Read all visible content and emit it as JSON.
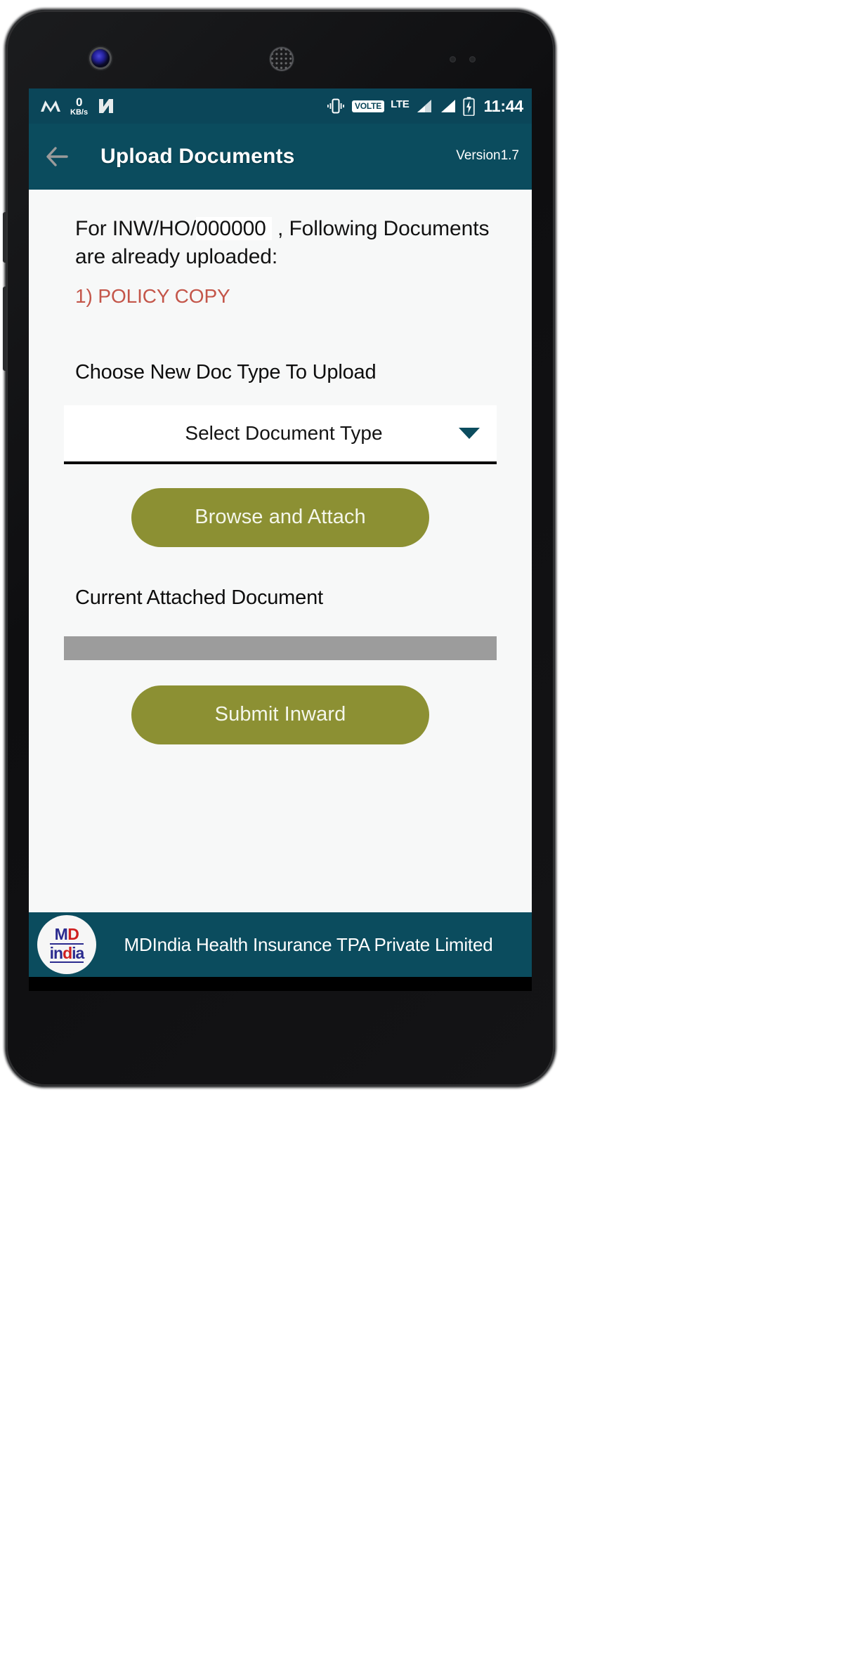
{
  "status_bar": {
    "network_speed_value": "0",
    "network_speed_unit": "KB/s",
    "volte_label": "VOLTE",
    "network_type": "LTE",
    "clock": "11:44",
    "icons": [
      "m-logo-icon",
      "network-speed-icon",
      "android-nougat-icon",
      "vibrate-icon",
      "volte-badge",
      "signal-bar-icon",
      "battery-charging-icon"
    ],
    "background_color": "#0b4659"
  },
  "app_bar": {
    "back_icon": "back-arrow-icon",
    "title": "Upload Documents",
    "version": "Version1.7",
    "background_color": "#0b4c5e"
  },
  "content": {
    "headline_prefix": "For INW/HO/",
    "headline_redacted": "000000",
    "headline_suffix": " , Following Documents are already uploaded:",
    "uploaded_documents": [
      {
        "label": "1) POLICY COPY",
        "color": "#c4564a"
      }
    ],
    "choose_doc_label": "Choose New Doc Type To Upload",
    "doc_type_spinner": {
      "selected": "Select Document Type",
      "placeholder": "Select Document Type",
      "caret_icon": "chevron-down-icon"
    },
    "browse_button_label": "Browse and Attach",
    "current_doc_label": "Current Attached Document",
    "current_doc_value": "",
    "submit_button_label": "Submit Inward",
    "button_color": "#8c9033",
    "background_color": "#f7f8f8"
  },
  "footer": {
    "logo": {
      "top_left": "MD",
      "top_left_a": "M",
      "top_left_b": "D",
      "bottom_a": "in",
      "bottom_b": "d",
      "bottom_c": "ia",
      "blue": "#2b2b8f",
      "red": "#cf2020"
    },
    "company_name": "MDIndia Health Insurance TPA Private Limited",
    "background_color": "#0b4c5e"
  },
  "nav_bar": {
    "back_icon": "nav-back-triangle-icon",
    "home_icon": "nav-home-circle-icon",
    "recents_icon": "nav-recents-square-icon"
  }
}
